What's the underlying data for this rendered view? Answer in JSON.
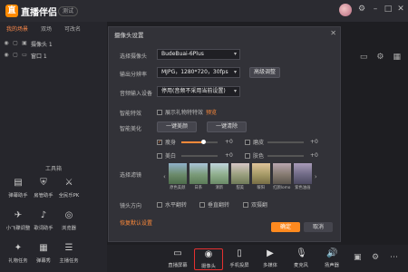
{
  "app": {
    "name": "直播伴侣",
    "badge": "测试"
  },
  "left": {
    "tabs": [
      "我的场景",
      "双场",
      "可改名"
    ],
    "scenes": [
      "摄像头 1",
      "窗口 1"
    ],
    "toolbox_title": "工具箱",
    "tools": [
      "弹幕助手",
      "房管助手",
      "全民乐PK",
      "小飞碟调整",
      "歌词助手",
      "浏览器",
      "礼物任务",
      "弹幕秀",
      "主播任务",
      "",
      "",
      ""
    ]
  },
  "dialog": {
    "title": "摄像头设置",
    "select_camera_label": "选择摄像头",
    "camera_value": "BudeBuai-6Plus",
    "resolution_label": "输出分辨率",
    "resolution_value": "MJPG，1280*720，30fps",
    "advanced_button": "高级调整",
    "audio_label": "音频输入设备",
    "audio_value": "停用(音频不采用当前设置)",
    "smart_effects_label": "智能特效",
    "gesture_label": "展示礼物特特效",
    "preview_link": "预览",
    "beauty_label": "智能美化",
    "one_key_beauty": "一键美颜",
    "one_key_clear": "一键清除",
    "effects": [
      {
        "name": "瘦身",
        "checked": true,
        "value": "+0"
      },
      {
        "name": "美白",
        "checked": false,
        "value": "+0"
      },
      {
        "name": "磨皮",
        "checked": false,
        "value": "+0"
      },
      {
        "name": "肤色",
        "checked": false,
        "value": "+0"
      }
    ],
    "filter_label": "选择滤镜",
    "filters": [
      "原色美颜",
      "日系",
      "清新",
      "甜美",
      "暖阳",
      "红颜lomo",
      "紫色油画"
    ],
    "mirror_label": "镜头方向",
    "mirror_options": [
      "水平翻转",
      "垂直翻转",
      "双摄翻"
    ],
    "reset_link": "恢复默认设置",
    "confirm": "确定",
    "cancel": "取消"
  },
  "bottom": {
    "buttons": [
      "直播屏幕",
      "摄像头",
      "手机投屏",
      "多媒体",
      "麦克风",
      "扬声器"
    ]
  },
  "colors": {
    "accent": "#ff8a1f",
    "highlight": "#e53030"
  },
  "icons": {
    "window": [
      "settings-icon",
      "minimize-icon",
      "restore-icon",
      "close-icon"
    ]
  }
}
